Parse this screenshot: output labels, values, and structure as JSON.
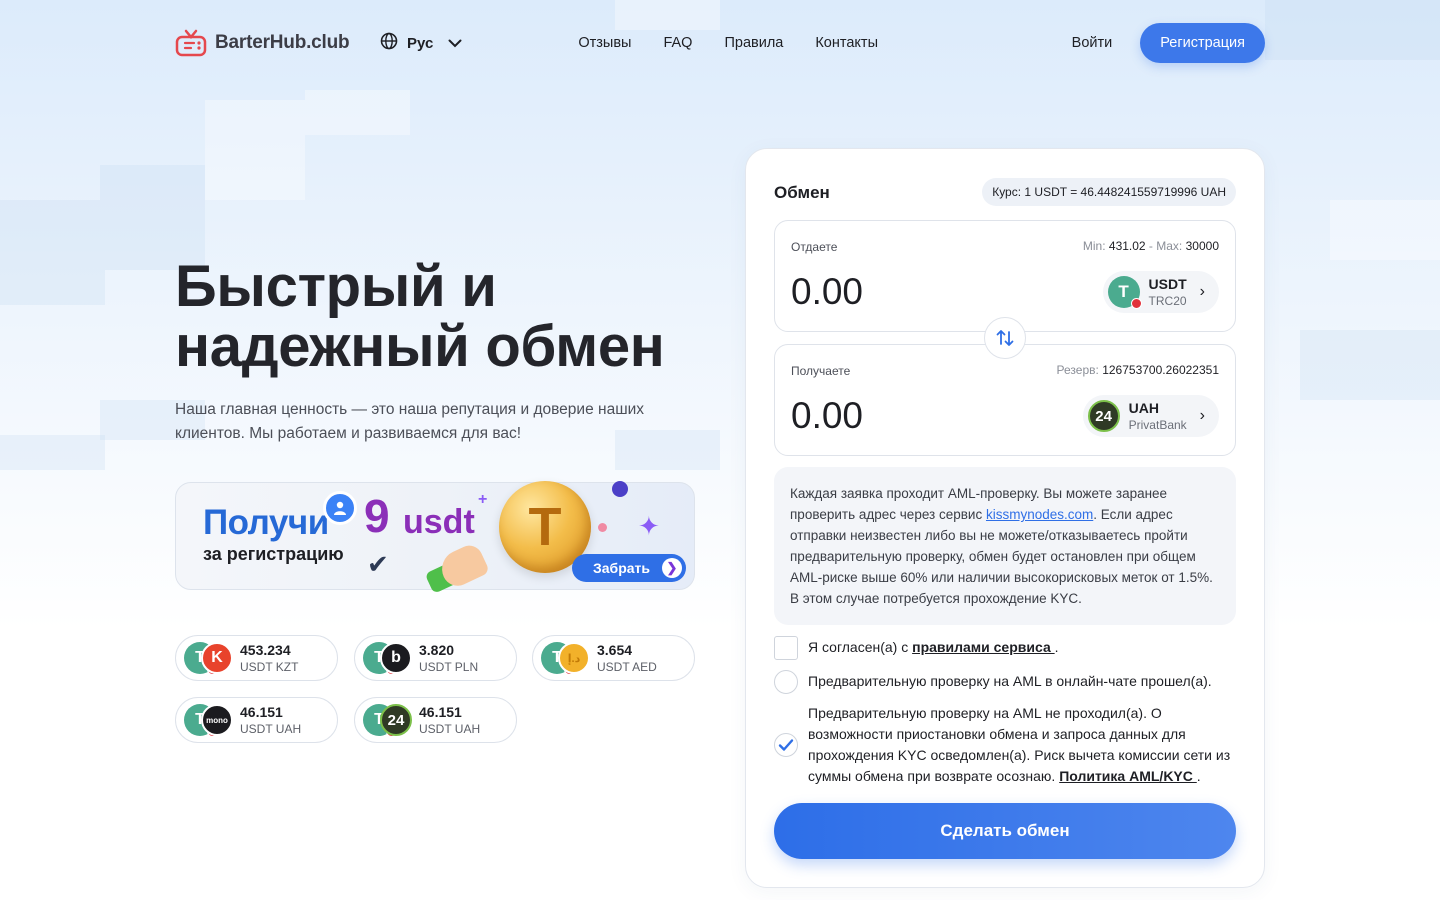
{
  "header": {
    "logo_text": "BarterHub.club",
    "language": "Рус",
    "nav": [
      "Отзывы",
      "FAQ",
      "Правила",
      "Контакты"
    ],
    "login": "Войти",
    "register": "Регистрация"
  },
  "hero": {
    "title": "Быстрый и надежный обмен",
    "subtitle": "Наша главная ценность — это наша репутация и доверие наших клиентов. Мы работаем и развиваемся для вас!"
  },
  "promo": {
    "title": "Получи",
    "subtitle": "за регистрацию",
    "amount": "9",
    "unit": "usdt",
    "coin_symbol": "T",
    "button": "Забрать"
  },
  "rates": [
    {
      "value": "453.234",
      "pair": "USDT KZT",
      "icon2": "kzt-bank-icon",
      "color2": "#e8432c",
      "glyph2": "K"
    },
    {
      "value": "3.820",
      "pair": "USDT PLN",
      "icon2": "pln-bank-icon",
      "color2": "#1b1b1f",
      "glyph2": "b"
    },
    {
      "value": "3.654",
      "pair": "USDT AED",
      "icon2": "aed-coin-icon",
      "color2": "#f2b12a",
      "glyph2": "د.إ"
    },
    {
      "value": "46.151",
      "pair": "USDT UAH",
      "icon2": "monobank-icon",
      "color2": "#1b1b1f",
      "glyph2": "mono"
    },
    {
      "value": "46.151",
      "pair": "USDT UAH",
      "icon2": "privatbank-icon",
      "color2": "#2f3a25",
      "glyph2": "24"
    }
  ],
  "exchange": {
    "title": "Обмен",
    "rate": "Курс: 1 USDT = 46.448241559719996 UAH",
    "give": {
      "label": "Отдаете",
      "min_label": "Min:",
      "min": "431.02",
      "sep": " - ",
      "max_label": "Max:",
      "max": "30000",
      "amount": "0.00",
      "code": "USDT",
      "network": "TRC20"
    },
    "get": {
      "label": "Получаете",
      "reserve_label": "Резерв:",
      "reserve": "126753700.26022351",
      "amount": "0.00",
      "code": "UAH",
      "network": "PrivatBank",
      "icon_glyph": "24"
    },
    "aml_before": "Каждая заявка проходит AML-проверку. Вы можете заранее проверить адрес через сервис ",
    "aml_link": "kissmynodes.com",
    "aml_after": ". Если адрес отправки неизвестен либо вы не можете/отказываетесь пройти предварительную проверку, обмен будет остановлен при общем AML-риске выше 60% или наличии высокорисковых меток от 1.5%. В этом случае потребуется прохождение KYC.",
    "agree_before": "Я согласен(а) с ",
    "agree_link": "правилами сервиса ",
    "agree_after": ".",
    "option1": "Предварительную проверку на AML в онлайн-чате прошел(а).",
    "option2_before": "Предварительную проверку на AML не проходил(а). О возможности приостановки обмена и запроса данных для прохождения KYC осведомлен(а). Риск вычета комиссии сети из суммы обмена при возврате осознаю. ",
    "option2_link": "Политика AML/KYC ",
    "option2_after": ".",
    "option2_checked": true,
    "submit": "Сделать обмен"
  },
  "colors": {
    "accent": "#3d78ea",
    "usdt": "#4bab8f",
    "promo_purple": "#8b2fb8"
  }
}
